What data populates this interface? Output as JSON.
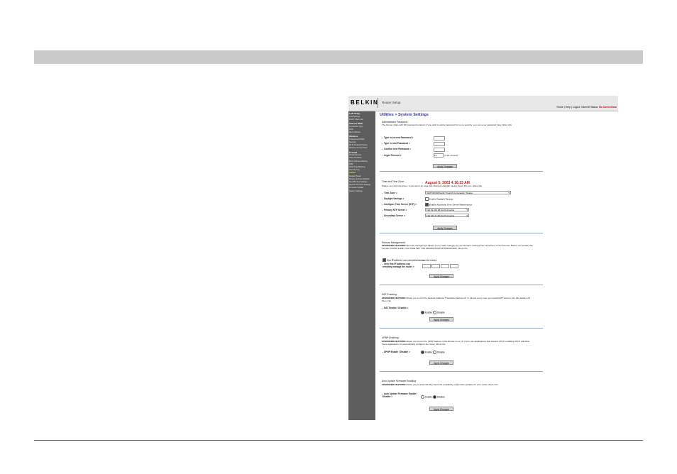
{
  "header": {
    "logo": "BELKIN",
    "product": "Router Setup",
    "links": "Home | Help | Logout",
    "status_label": "Internet Status:",
    "status_value": "No Connection"
  },
  "sidebar": [
    {
      "label": "LAN Setup",
      "type": "section"
    },
    {
      "label": "LAN Settings",
      "type": "item"
    },
    {
      "label": "DHCP Client List",
      "type": "item"
    },
    {
      "label": "Internet WAN",
      "type": "section"
    },
    {
      "label": "Connection Type",
      "type": "item"
    },
    {
      "label": "DNS",
      "type": "item"
    },
    {
      "label": "MAC Address",
      "type": "item"
    },
    {
      "label": "Wireless",
      "type": "section"
    },
    {
      "label": "Channel and SSID",
      "type": "item"
    },
    {
      "label": "Security",
      "type": "item"
    },
    {
      "label": "Wi-Fi Protected Setup",
      "type": "item"
    },
    {
      "label": "Wireless Access Point",
      "type": "item"
    },
    {
      "label": "Firewall",
      "type": "section"
    },
    {
      "label": "Virtual Servers",
      "type": "item"
    },
    {
      "label": "Client IP Filters",
      "type": "item"
    },
    {
      "label": "MAC Address Filtering",
      "type": "item"
    },
    {
      "label": "DMZ",
      "type": "item"
    },
    {
      "label": "WAN Ping Blocking",
      "type": "item"
    },
    {
      "label": "Security Log",
      "type": "item"
    },
    {
      "label": "Utilities",
      "type": "active"
    },
    {
      "label": "Restart Router",
      "type": "item"
    },
    {
      "label": "Restore Factory Defaults",
      "type": "item"
    },
    {
      "label": "Save/Backup Settings",
      "type": "item"
    },
    {
      "label": "Restore Previous Settings",
      "type": "item"
    },
    {
      "label": "Firmware Update",
      "type": "item"
    },
    {
      "label": "System Settings",
      "type": "item"
    }
  ],
  "page": {
    "title": "Utilities > System Settings",
    "apply_label": "Apply Changes"
  },
  "admin": {
    "title": "Administrator Password:",
    "desc": "The Router ships with NO password entered. If you wish to add a password for more security, you can set a password here.",
    "more": "More Info",
    "current_label": "- Type in current Password >",
    "new_label": "- Type in new Password >",
    "confirm_label": "- Confirm new Password >",
    "timeout_label": "- Login Timeout >",
    "timeout_value": "10",
    "timeout_hint": "(1-99 minutes)"
  },
  "time": {
    "title": "Time and Time Zone:",
    "datetime": "August 5, 2003 4:16:33 AM",
    "desc": "Please set your time Zone. If you are in an area that observes daylight saving check this box.",
    "more": "More Info",
    "zone_label": "- Time Zone >",
    "zone_value": "(GMT-08:00)Pacific Time(US & Canada); Tijuana",
    "dst_label": "- Daylight Savings >",
    "dst_option": "Enable Daylight Savings",
    "ntp_label": "- Configure Time Server (NTP) >",
    "ntp_option": "Enable Automatic Time Server Maintenance",
    "primary_label": "- Primary NTP Server >",
    "primary_value": "192.43.244.18-North America",
    "secondary_label": "- Secondary Server >",
    "secondary_value": "132.163.4.102-North America"
  },
  "remote": {
    "title": "Remote Management:",
    "desc_bold": "ADVANCED FEATURE!",
    "desc": " Remote management allows you to make changes to your Router's settings from anywhere on the Internet. Before you enable this function, MAKE SURE YOU HAVE SET THE ADMINISTRATOR PASSWORD.",
    "more": "More Info",
    "any_ip": "Any IP address can remotely manage the router.",
    "only_label_1": "- Only this IP address can",
    "only_label_2": "remotely    manage the router >"
  },
  "nat": {
    "title": "NAT Enabling:",
    "desc_bold": "ADVANCED FEATURE!",
    "desc": " Allows you to turn the Network Address Translation feature off. In almost every case you would NOT want to turn this feature off.",
    "more": "More Info",
    "label": "- NAT Enable / Disable >",
    "enable": "Enable",
    "disable": "Disable"
  },
  "upnp": {
    "title": "UPNP Enabling:",
    "desc_bold": "ADVANCED FEATURE!",
    "desc": " Allows you to turn the UPNP feature of the Router on or off. If you use applications that support UPnP, enabling UPnP will allow these applications to automatically configure the router.",
    "more": "More Info",
    "label": "- UPNP Enable / Disable >",
    "enable": "Enable",
    "disable": "Disable"
  },
  "firmware": {
    "title": "Auto Update Firmware Enabling:",
    "desc_bold": "ADVANCED FEATURE!",
    "desc": " Allows you to automatically check the availability of firmware updates for your router.",
    "more": "More Info",
    "label_1": "- Auto Update Firmware Enable /",
    "label_2": "Disable >",
    "enable": "Enable",
    "disable": "Disable"
  }
}
